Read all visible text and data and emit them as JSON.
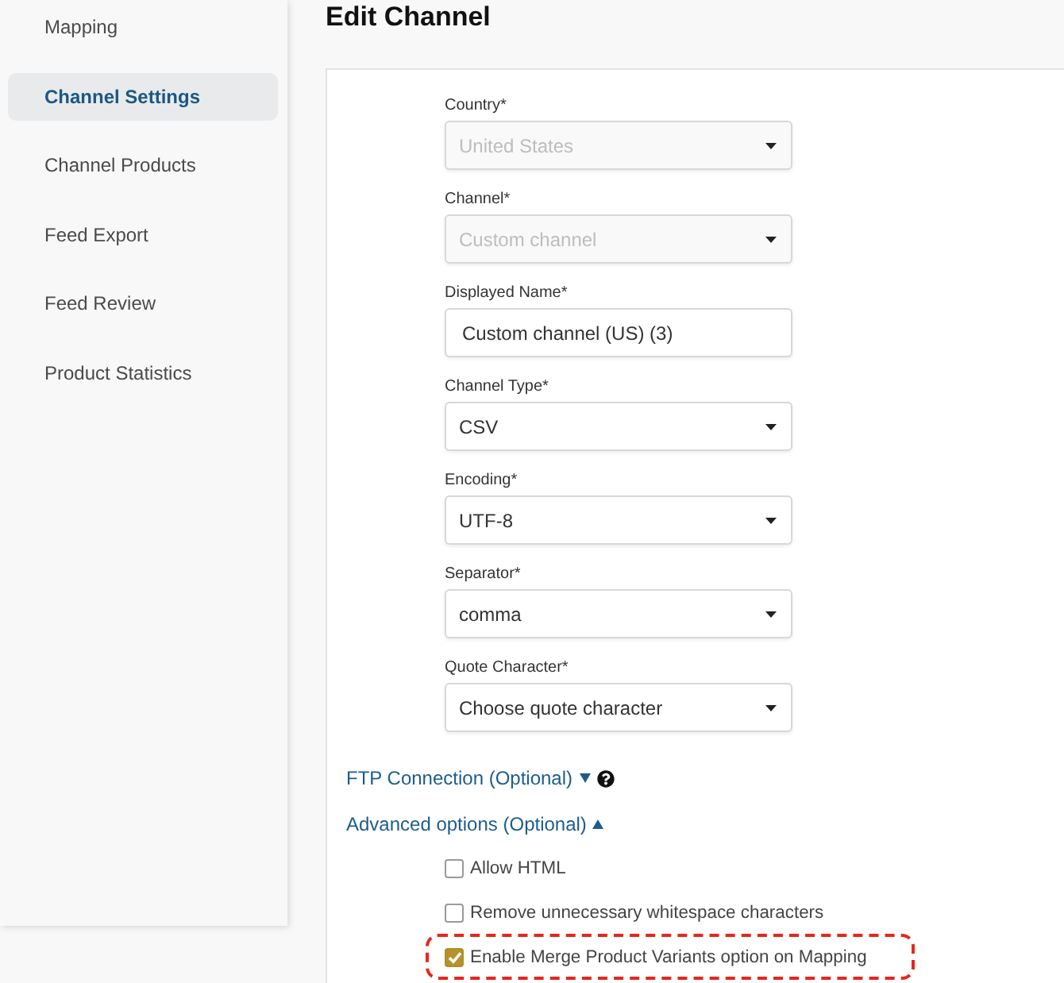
{
  "sidebar": {
    "items": [
      {
        "label": "Mapping",
        "selected": false
      },
      {
        "label": "Channel Settings",
        "selected": true
      },
      {
        "label": "Channel Products",
        "selected": false
      },
      {
        "label": "Feed Export",
        "selected": false
      },
      {
        "label": "Feed Review",
        "selected": false
      },
      {
        "label": "Product Statistics",
        "selected": false
      }
    ]
  },
  "page": {
    "title": "Edit Channel"
  },
  "form": {
    "fields": [
      {
        "kind": "select",
        "label": "Country*",
        "value": "United States",
        "disabled": true
      },
      {
        "kind": "select",
        "label": "Channel*",
        "value": "Custom channel",
        "disabled": true
      },
      {
        "kind": "text",
        "label": "Displayed Name*",
        "value": "Custom channel (US) (3)",
        "disabled": false
      },
      {
        "kind": "select",
        "label": "Channel Type*",
        "value": "CSV",
        "disabled": false
      },
      {
        "kind": "select",
        "label": "Encoding*",
        "value": "UTF-8",
        "disabled": false
      },
      {
        "kind": "select",
        "label": "Separator*",
        "value": "comma",
        "disabled": false
      },
      {
        "kind": "select",
        "label": "Quote Character*",
        "value": "Choose quote character",
        "disabled": false
      }
    ]
  },
  "sections": [
    {
      "label": "FTP Connection (Optional)",
      "expanded": false,
      "help": true
    },
    {
      "label": "Advanced options (Optional)",
      "expanded": true,
      "help": false,
      "options": [
        {
          "label": "Allow HTML",
          "checked": false,
          "highlighted": false
        },
        {
          "label": "Remove unnecessary whitespace characters",
          "checked": false,
          "highlighted": false
        },
        {
          "label": "Enable Merge Product Variants option on Mapping",
          "checked": true,
          "highlighted": true
        }
      ]
    }
  ]
}
